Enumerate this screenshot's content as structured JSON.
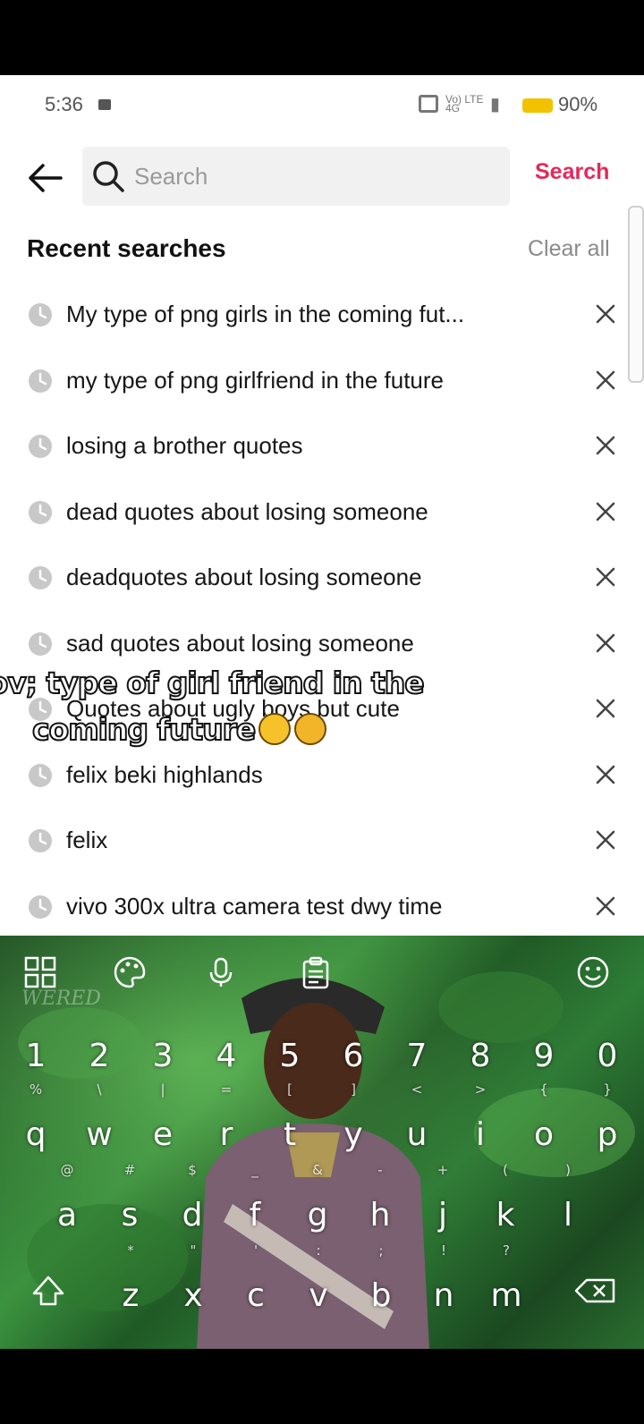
{
  "status_bar": {
    "time": "5:36",
    "network": "Vo) LTE",
    "network_type": "4G",
    "battery": "90%"
  },
  "search": {
    "placeholder": "Search",
    "submit_label": "Search"
  },
  "recent": {
    "title": "Recent searches",
    "clear_label": "Clear all",
    "items": [
      {
        "label": "My type of png girls in the coming fut..."
      },
      {
        "label": "my type of png girlfriend in the future"
      },
      {
        "label": "losing a brother quotes"
      },
      {
        "label": "dead quotes about losing someone"
      },
      {
        "label": "deadquotes about losing someone"
      },
      {
        "label": "sad quotes about losing someone"
      },
      {
        "label": "Quotes about ugly boys but cute"
      },
      {
        "label": "felix beki highlands"
      },
      {
        "label": "felix"
      },
      {
        "label": "vivo 300x ultra camera test dwy time"
      }
    ]
  },
  "caption": {
    "line1": "pov; type of girl friend in the",
    "line2": "coming future"
  },
  "keyboard": {
    "watermark": "WERED",
    "number_row": [
      "1",
      "2",
      "3",
      "4",
      "5",
      "6",
      "7",
      "8",
      "9",
      "0"
    ],
    "row1": [
      {
        "k": "q",
        "s": "%"
      },
      {
        "k": "w",
        "s": "\\"
      },
      {
        "k": "e",
        "s": "|"
      },
      {
        "k": "r",
        "s": "="
      },
      {
        "k": "t",
        "s": "["
      },
      {
        "k": "y",
        "s": "]"
      },
      {
        "k": "u",
        "s": "<"
      },
      {
        "k": "i",
        "s": ">"
      },
      {
        "k": "o",
        "s": "{"
      },
      {
        "k": "p",
        "s": "}"
      }
    ],
    "row2": [
      {
        "k": "a",
        "s": "@"
      },
      {
        "k": "s",
        "s": "#"
      },
      {
        "k": "d",
        "s": "$"
      },
      {
        "k": "f",
        "s": "_"
      },
      {
        "k": "g",
        "s": "&"
      },
      {
        "k": "h",
        "s": "-"
      },
      {
        "k": "j",
        "s": "+"
      },
      {
        "k": "k",
        "s": "("
      },
      {
        "k": "l",
        "s": ")"
      }
    ],
    "row3": [
      {
        "k": "z",
        "s": "*"
      },
      {
        "k": "x",
        "s": "\""
      },
      {
        "k": "c",
        "s": "'"
      },
      {
        "k": "v",
        "s": ":"
      },
      {
        "k": "b",
        "s": ";"
      },
      {
        "k": "n",
        "s": "!"
      },
      {
        "k": "m",
        "s": "?"
      }
    ]
  },
  "colors": {
    "accent": "#e6295a",
    "muted": "#8a8a8a",
    "text": "#161616"
  }
}
